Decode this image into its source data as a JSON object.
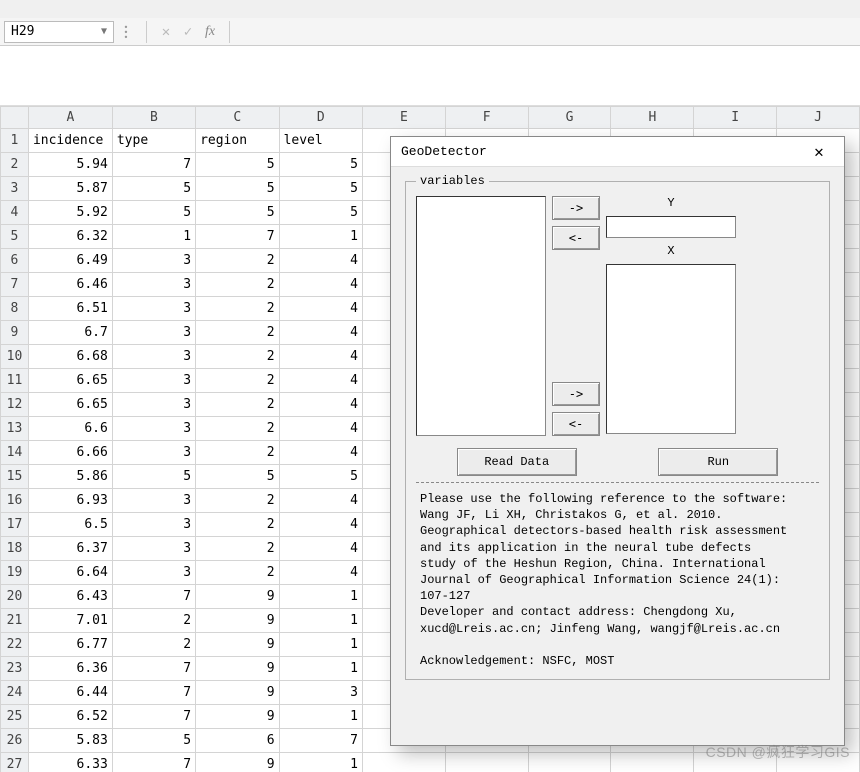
{
  "formula_bar": {
    "cell_ref": "H29",
    "cancel_glyph": "✕",
    "confirm_glyph": "✓",
    "fx_glyph": "fx",
    "formula_value": ""
  },
  "grid": {
    "columns": [
      "A",
      "B",
      "C",
      "D",
      "E",
      "F",
      "G",
      "H",
      "I",
      "J"
    ],
    "active_col": "H",
    "headers": [
      "incidence",
      "type",
      "region",
      "level"
    ],
    "rows": [
      {
        "r": 1,
        "A": "incidence",
        "B": "type",
        "C": "region",
        "D": "level"
      },
      {
        "r": 2,
        "A": "5.94",
        "B": "7",
        "C": "5",
        "D": "5"
      },
      {
        "r": 3,
        "A": "5.87",
        "B": "5",
        "C": "5",
        "D": "5"
      },
      {
        "r": 4,
        "A": "5.92",
        "B": "5",
        "C": "5",
        "D": "5"
      },
      {
        "r": 5,
        "A": "6.32",
        "B": "1",
        "C": "7",
        "D": "1"
      },
      {
        "r": 6,
        "A": "6.49",
        "B": "3",
        "C": "2",
        "D": "4"
      },
      {
        "r": 7,
        "A": "6.46",
        "B": "3",
        "C": "2",
        "D": "4"
      },
      {
        "r": 8,
        "A": "6.51",
        "B": "3",
        "C": "2",
        "D": "4"
      },
      {
        "r": 9,
        "A": "6.7",
        "B": "3",
        "C": "2",
        "D": "4"
      },
      {
        "r": 10,
        "A": "6.68",
        "B": "3",
        "C": "2",
        "D": "4"
      },
      {
        "r": 11,
        "A": "6.65",
        "B": "3",
        "C": "2",
        "D": "4"
      },
      {
        "r": 12,
        "A": "6.65",
        "B": "3",
        "C": "2",
        "D": "4"
      },
      {
        "r": 13,
        "A": "6.6",
        "B": "3",
        "C": "2",
        "D": "4"
      },
      {
        "r": 14,
        "A": "6.66",
        "B": "3",
        "C": "2",
        "D": "4"
      },
      {
        "r": 15,
        "A": "5.86",
        "B": "5",
        "C": "5",
        "D": "5"
      },
      {
        "r": 16,
        "A": "6.93",
        "B": "3",
        "C": "2",
        "D": "4"
      },
      {
        "r": 17,
        "A": "6.5",
        "B": "3",
        "C": "2",
        "D": "4"
      },
      {
        "r": 18,
        "A": "6.37",
        "B": "3",
        "C": "2",
        "D": "4"
      },
      {
        "r": 19,
        "A": "6.64",
        "B": "3",
        "C": "2",
        "D": "4"
      },
      {
        "r": 20,
        "A": "6.43",
        "B": "7",
        "C": "9",
        "D": "1"
      },
      {
        "r": 21,
        "A": "7.01",
        "B": "2",
        "C": "9",
        "D": "1"
      },
      {
        "r": 22,
        "A": "6.77",
        "B": "2",
        "C": "9",
        "D": "1"
      },
      {
        "r": 23,
        "A": "6.36",
        "B": "7",
        "C": "9",
        "D": "1"
      },
      {
        "r": 24,
        "A": "6.44",
        "B": "7",
        "C": "9",
        "D": "3"
      },
      {
        "r": 25,
        "A": "6.52",
        "B": "7",
        "C": "9",
        "D": "1"
      },
      {
        "r": 26,
        "A": "5.83",
        "B": "5",
        "C": "6",
        "D": "7"
      },
      {
        "r": 27,
        "A": "6.33",
        "B": "7",
        "C": "9",
        "D": "1"
      }
    ]
  },
  "dialog": {
    "title": "GeoDetector",
    "close": "✕",
    "variables_legend": "variables",
    "arrow_right": "->",
    "arrow_left": "<-",
    "y_label": "Y",
    "x_label": "X",
    "read_btn": "Read Data",
    "run_btn": "Run",
    "reference": "Please use the following reference to the software:\nWang JF, Li XH, Christakos G, et al. 2010.\nGeographical detectors-based health risk assessment\nand its application in the neural tube defects\nstudy of the Heshun Region, China. International\nJournal of Geographical Information Science 24(1):\n107-127\nDeveloper and contact address: Chengdong Xu,\nxucd@Lreis.ac.cn; Jinfeng Wang, wangjf@Lreis.ac.cn\n\nAcknowledgement: NSFC, MOST"
  },
  "watermark": "CSDN @疯狂学习GIS"
}
